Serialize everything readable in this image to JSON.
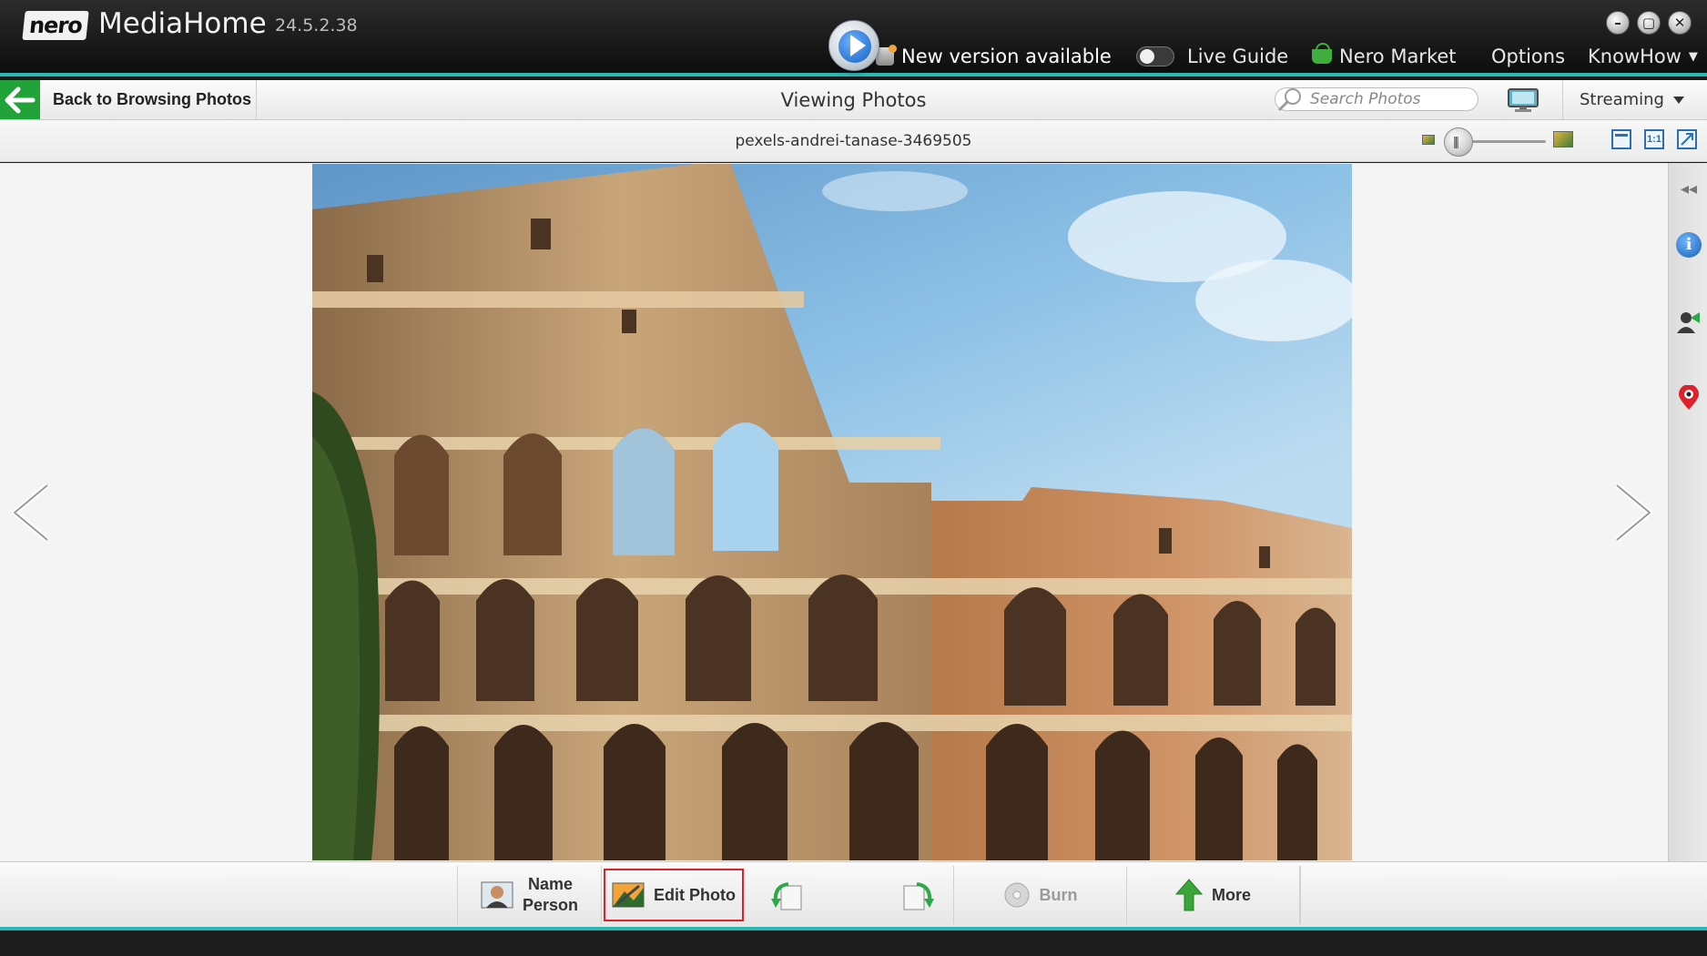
{
  "window": {
    "logo_text": "nero",
    "app_title": "MediaHome",
    "version": "24.5.2.38",
    "controls": {
      "minimize_icon": "minimize-icon",
      "maximize_icon": "maximize-icon",
      "close_icon": "close-icon"
    }
  },
  "top_menu": {
    "new_version": "New version available",
    "live_guide": "Live Guide",
    "live_guide_enabled": false,
    "nero_market": "Nero Market",
    "options": "Options",
    "knowhow": "KnowHow"
  },
  "toolbar": {
    "back_label": "Back to Browsing Photos",
    "title": "Viewing Photos",
    "search_placeholder": "Search Photos",
    "streaming_label": "Streaming"
  },
  "filebar": {
    "file_name": "pexels-andrei-tanase-3469505",
    "zoom_level": 0.05,
    "view_buttons": [
      "fit-width",
      "1:1",
      "fit-screen"
    ],
    "actual_size_label": "1:1"
  },
  "viewer": {
    "photo_subject": "colosseum-photo",
    "prev_icon": "chevron-left-icon",
    "next_icon": "chevron-right-icon"
  },
  "side_panel": {
    "icons": [
      "collapse-icon",
      "info-icon",
      "person-tag-icon",
      "location-pin-icon"
    ],
    "collapse_glyph": "◂◂",
    "info_glyph": "i"
  },
  "actions": {
    "name_person": "Name\nPerson",
    "name_person_line1": "Name",
    "name_person_line2": "Person",
    "edit_photo": "Edit Photo",
    "burn": "Burn",
    "more": "More"
  },
  "colors": {
    "accent_teal": "#2bb7b3",
    "back_green": "#22a33a",
    "highlight_red": "#e0202a",
    "play_blue": "#1560c4"
  }
}
